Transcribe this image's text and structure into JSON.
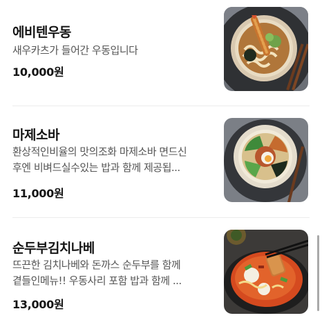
{
  "menu": {
    "items": [
      {
        "name": "에비텐우동",
        "description_lines": [
          "새우카츠가 들어간 우동입니다"
        ],
        "price": "10,000원",
        "image_icon": "shrimp-tempura-udon-photo"
      },
      {
        "name": "마제소바",
        "description_lines": [
          "환상적인비율의 맛의조화 마제소바 면드신",
          "후엔 비벼드실수있는 밥과 함께 제공됩..."
        ],
        "price": "11,000원",
        "image_icon": "mazesoba-photo"
      },
      {
        "name": "순두부김치나베",
        "description_lines": [
          "뜨끈한 김치나베와 돈까스 순두부를 함께",
          "곁들인메뉴!! 우동사리 포함 밥과 함께 ..."
        ],
        "price": "13,000원",
        "image_icon": "sundubu-kimchi-nabe-photo"
      }
    ]
  },
  "colors": {
    "text_primary": "#141414",
    "text_secondary": "#555555",
    "divider": "#ececec",
    "scrollbar": "#a9a9a9"
  }
}
